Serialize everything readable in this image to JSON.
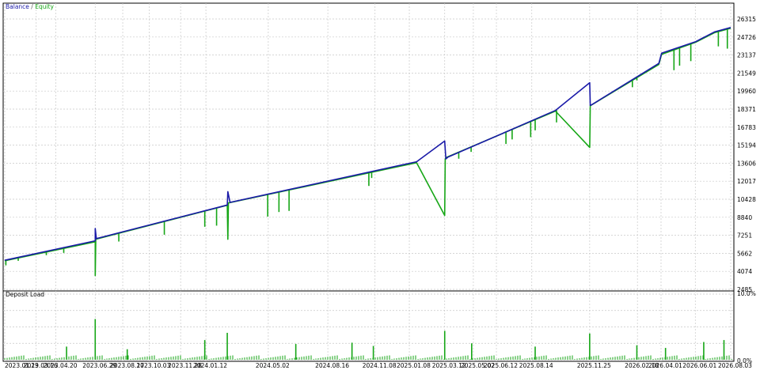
{
  "chart_data": [
    {
      "type": "line",
      "title": "",
      "legend": {
        "position": "top-left",
        "separator": " / "
      },
      "series": [
        {
          "name": "Balance",
          "color": "#1a1aa8",
          "x": [
            "2023.01.19",
            "2023.06.29",
            "2023.06.29",
            "2023.07.01",
            "2024.02.19",
            "2024.02.20",
            "2024.02.24",
            "2025.01.21",
            "2025.03.12",
            "2025.03.14",
            "2025.03.18",
            "2025.09.25",
            "2025.11.25",
            "2025.11.26",
            "2025.11.29",
            "2026.03.28",
            "2026.04.02",
            "2026.06.01",
            "2026.07.05",
            "2026.08.03"
          ],
          "values": [
            5050,
            6760,
            7850,
            6960,
            9920,
            11100,
            10150,
            13730,
            15560,
            13980,
            14150,
            18250,
            20700,
            18700,
            18770,
            22400,
            23300,
            24300,
            25170,
            25560
          ]
        },
        {
          "name": "Equity",
          "color": "#16a616",
          "x": [
            "2023.01.19",
            "2023.06.29",
            "2023.06.29",
            "2023.06.30",
            "2024.02.19",
            "2024.02.20",
            "2024.02.21",
            "2025.01.21",
            "2025.03.12",
            "2025.03.13",
            "2025.03.14",
            "2025.09.25",
            "2025.11.25",
            "2025.11.26",
            "2025.11.27",
            "2026.03.28",
            "2026.04.02",
            "2026.06.01",
            "2026.07.05",
            "2026.08.03"
          ],
          "values": [
            5000,
            6680,
            3700,
            6900,
            9900,
            6900,
            10100,
            13650,
            9000,
            13950,
            14100,
            18200,
            15000,
            18650,
            18700,
            22300,
            23200,
            24250,
            25100,
            25500
          ]
        }
      ],
      "equity_drops": [
        {
          "x": "2023.01.21",
          "y": 4600
        },
        {
          "x": "2023.02.12",
          "y": 5000
        },
        {
          "x": "2023.04.03",
          "y": 5500
        },
        {
          "x": "2023.05.04",
          "y": 5700
        },
        {
          "x": "2023.08.10",
          "y": 6700
        },
        {
          "x": "2023.10.30",
          "y": 7300
        },
        {
          "x": "2024.01.10",
          "y": 8000
        },
        {
          "x": "2024.01.31",
          "y": 8100
        },
        {
          "x": "2024.05.01",
          "y": 8900
        },
        {
          "x": "2024.05.21",
          "y": 9300
        },
        {
          "x": "2024.06.08",
          "y": 9400
        },
        {
          "x": "2024.10.28",
          "y": 11600
        },
        {
          "x": "2024.11.02",
          "y": 12300
        },
        {
          "x": "2025.04.06",
          "y": 14000
        },
        {
          "x": "2025.04.28",
          "y": 14600
        },
        {
          "x": "2025.06.29",
          "y": 15300
        },
        {
          "x": "2025.07.10",
          "y": 15700
        },
        {
          "x": "2025.08.12",
          "y": 15900
        },
        {
          "x": "2025.08.20",
          "y": 16500
        },
        {
          "x": "2025.09.27",
          "y": 17200
        },
        {
          "x": "2026.02.09",
          "y": 20300
        },
        {
          "x": "2026.02.17",
          "y": 20900
        },
        {
          "x": "2026.04.24",
          "y": 21800
        },
        {
          "x": "2026.05.04",
          "y": 22200
        },
        {
          "x": "2026.05.24",
          "y": 22600
        },
        {
          "x": "2026.07.12",
          "y": 23900
        },
        {
          "x": "2026.07.28",
          "y": 23700
        }
      ],
      "xlim": [
        "2023.01.19",
        "2026.08.03"
      ],
      "ylim": [
        2485,
        27400
      ],
      "y_ticks": [
        2485,
        4074,
        5662,
        7251,
        8840,
        10428,
        12017,
        13606,
        15194,
        16783,
        18371,
        19960,
        21549,
        23137,
        24726,
        26315
      ],
      "x_ticks": [
        "2023.01.19",
        "2023.03.16",
        "2023.04.20",
        "2023.06.29",
        "2023.08.17",
        "2023.10.03",
        "2023.11.28",
        "2024.01.12",
        "2024.05.02",
        "2024.08.16",
        "2024.11.08",
        "2025.01.08",
        "2025.03.12",
        "2025.05.02",
        "2025.06.12",
        "2025.08.14",
        "2025.11.25",
        "2026.02.18",
        "2026.04.01",
        "2026.06.01",
        "2026.08.03"
      ],
      "grid": true
    },
    {
      "type": "bar",
      "title": "Deposit Load",
      "color": "#16a616",
      "ylim": [
        0,
        10
      ],
      "y_ticks": [
        "10.0%",
        "0.0%"
      ],
      "values": [
        {
          "x": "2023.06.29",
          "v": 6.2
        },
        {
          "x": "2024.02.19",
          "v": 4.1
        },
        {
          "x": "2025.03.12",
          "v": 4.4
        },
        {
          "x": "2025.11.25",
          "v": 4.0
        },
        {
          "x": "2024.01.10",
          "v": 3.0
        },
        {
          "x": "2024.06.20",
          "v": 2.4
        },
        {
          "x": "2024.09.28",
          "v": 2.6
        },
        {
          "x": "2025.04.29",
          "v": 2.5
        },
        {
          "x": "2025.08.20",
          "v": 2.0
        },
        {
          "x": "2026.02.17",
          "v": 2.2
        },
        {
          "x": "2026.06.16",
          "v": 2.7
        },
        {
          "x": "2026.07.22",
          "v": 3.0
        },
        {
          "x": "2023.05.09",
          "v": 2.0
        },
        {
          "x": "2023.08.25",
          "v": 1.6
        },
        {
          "x": "2024.11.05",
          "v": 2.1
        },
        {
          "x": "2026.04.09",
          "v": 1.8
        }
      ]
    }
  ]
}
